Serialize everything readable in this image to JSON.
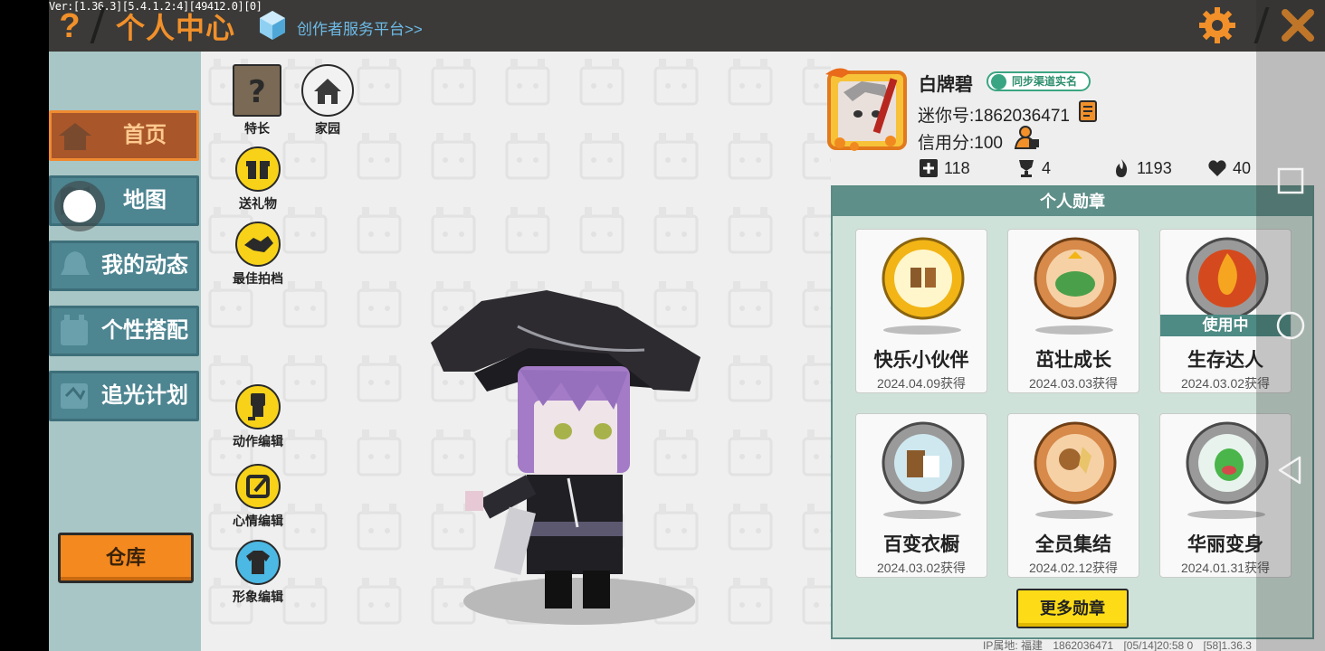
{
  "version": "Ver:[1.36.3][5.4.1.2:4][49412.0][0]",
  "header": {
    "help_icon": "question-mark-icon",
    "title": "个人中心",
    "creator_link": "创作者服务平台>>",
    "settings_icon": "gear-icon",
    "close_icon": "close-icon"
  },
  "sidebar": {
    "items": [
      {
        "label": "首页",
        "icon": "house-icon",
        "active": true
      },
      {
        "label": "地图",
        "icon": "map-icon",
        "active": false
      },
      {
        "label": "我的动态",
        "icon": "bell-icon",
        "active": false
      },
      {
        "label": "个性搭配",
        "icon": "outfit-icon",
        "active": false
      },
      {
        "label": "追光计划",
        "icon": "light-plan-icon",
        "active": false
      }
    ],
    "warehouse_label": "仓库"
  },
  "tools": {
    "specialty": "特长",
    "home": "家园",
    "gift": "送礼物",
    "partner": "最佳拍档",
    "action_edit": "动作编辑",
    "mood_edit": "心情编辑",
    "image_edit": "形象编辑"
  },
  "profile": {
    "username": "白牌碧",
    "realname_badge": "同步渠道实名",
    "mini_id": "迷你号:1862036471",
    "credit": "信用分:100",
    "stats": {
      "friends": "118",
      "trophies": "4",
      "popularity": "1193",
      "likes": "40"
    }
  },
  "medals": {
    "panel_title": "个人勋章",
    "items": [
      {
        "name": "快乐小伙伴",
        "date": "2024.04.09获得",
        "in_use": false,
        "color": "#f2b515"
      },
      {
        "name": "茁壮成长",
        "date": "2024.03.03获得",
        "in_use": false,
        "color": "#d78a4a"
      },
      {
        "name": "生存达人",
        "date": "2024.03.02获得",
        "in_use": true,
        "in_use_label": "使用中",
        "color": "#9a9a9a"
      },
      {
        "name": "百变衣橱",
        "date": "2024.03.02获得",
        "in_use": false,
        "color": "#9a9a9a"
      },
      {
        "name": "全员集结",
        "date": "2024.02.12获得",
        "in_use": false,
        "color": "#d78a4a"
      },
      {
        "name": "华丽变身",
        "date": "2024.01.31获得",
        "in_use": false,
        "color": "#9a9a9a"
      }
    ],
    "more_label": "更多勋章"
  },
  "footer": {
    "ip_location": "IP属地: 福建",
    "uid": "1862036471",
    "timestamp": "[05/14]20:58 0",
    "build": "[58]1.36.3"
  },
  "colors": {
    "accent_orange": "#f2902a",
    "topbar": "#3b3a38",
    "sidebar": "#a8c6c5",
    "nav_item": "#4d8591",
    "medal_panel": "#cfe2da",
    "yellow_button": "#fddc17"
  }
}
